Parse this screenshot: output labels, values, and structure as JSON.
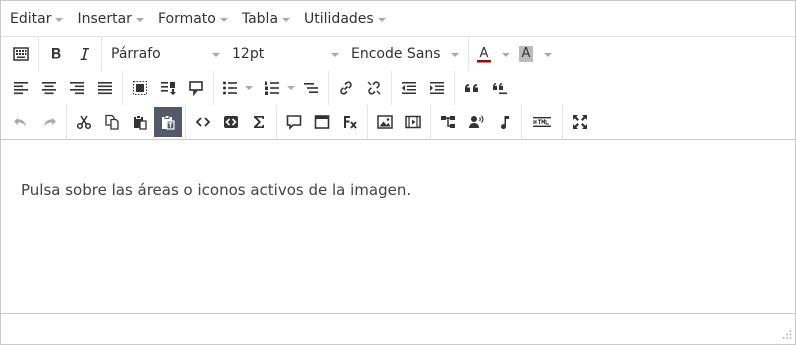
{
  "menubar": {
    "items": [
      {
        "label": "Editar"
      },
      {
        "label": "Insertar"
      },
      {
        "label": "Formato"
      },
      {
        "label": "Tabla"
      },
      {
        "label": "Utilidades"
      }
    ]
  },
  "toolbar": {
    "block_format": "Párrafo",
    "font_size": "12pt",
    "font_family": "Encode Sans",
    "text_color_letter": "A",
    "background_color_letter": "A",
    "colors": {
      "icon": "#333333",
      "text_color_underline": "#b00000",
      "background_color_fill": "#bbbbbb",
      "active_button": "#505a69"
    }
  },
  "content": {
    "text": "Pulsa sobre las áreas o iconos activos de la imagen."
  }
}
